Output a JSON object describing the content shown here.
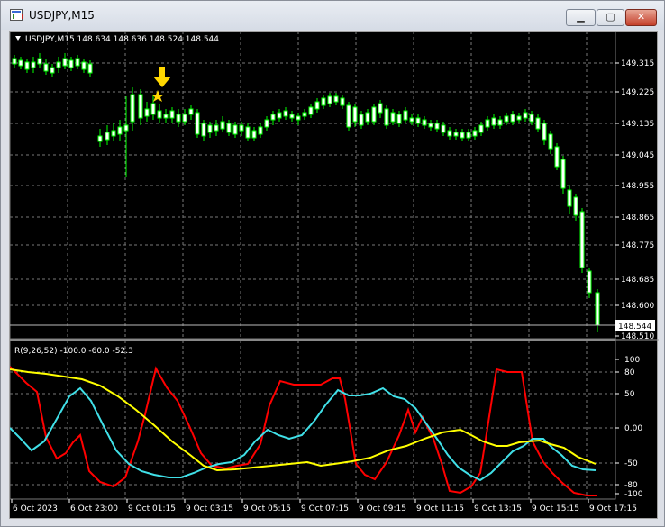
{
  "window": {
    "title": "USDJPY,M15",
    "controls": {
      "minimize": "▁",
      "maximize": "▢",
      "close": "✕"
    }
  },
  "chart": {
    "header": "USDJPY,M15  148.634 148.636 148.524 148.544",
    "price_labels": [
      "149.315",
      "149.225",
      "149.135",
      "149.045",
      "148.955",
      "148.865",
      "148.775",
      "148.685",
      "148.600",
      "148.510"
    ],
    "current_price": "148.544",
    "time_labels": [
      "6 Oct 2023",
      "6 Oct 23:00",
      "9 Oct 01:15",
      "9 Oct 03:15",
      "9 Oct 05:15",
      "9 Oct 07:15",
      "9 Oct 09:15",
      "9 Oct 11:15",
      "9 Oct 13:15",
      "9 Oct 15:15",
      "9 Oct 17:15"
    ],
    "indicator_header": "R(9,26,52) -100.0 -60.0 -52.3",
    "indicator_labels": [
      "100",
      "80",
      "50",
      "0.00",
      "-50",
      "-80",
      "-100"
    ],
    "colors": {
      "up_candle": "#00ff00",
      "down_candle": "#ffffff",
      "red_line": "#ff0000",
      "cyan_line": "#40e0e8",
      "yellow_line": "#ffff00",
      "marker": "#ffd700"
    },
    "marker": {
      "icon": "arrow-down-and-star"
    }
  }
}
